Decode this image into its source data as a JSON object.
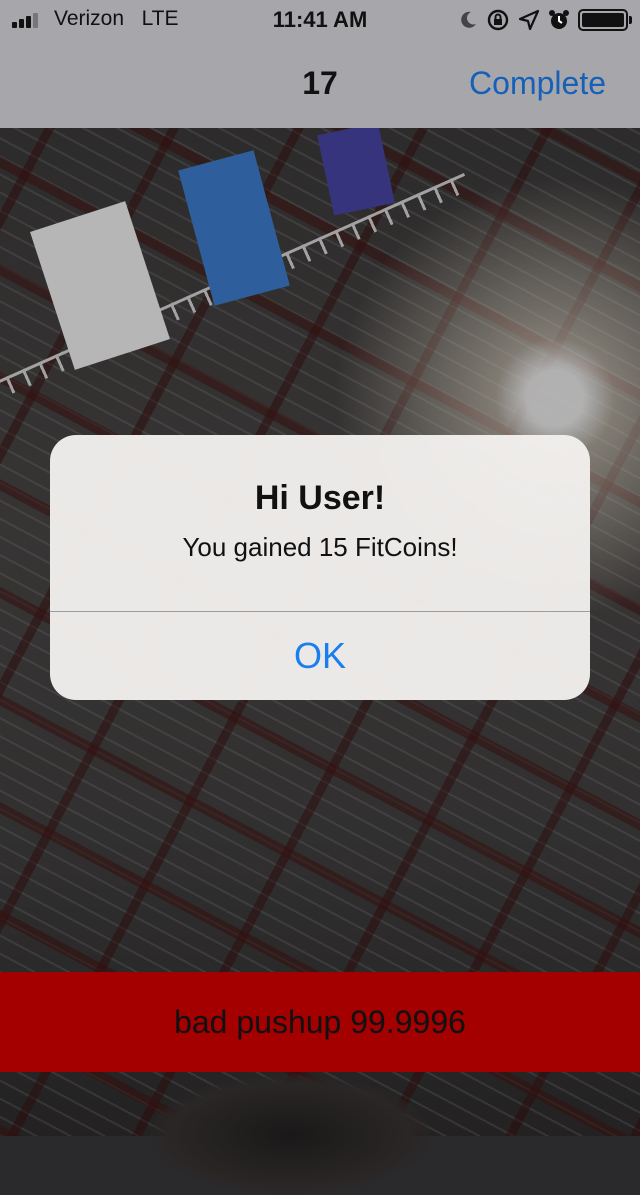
{
  "status_bar": {
    "carrier": "Verizon",
    "network": "LTE",
    "time": "11:41 AM",
    "icons": [
      "moon-icon",
      "rotation-lock-icon",
      "location-arrow-icon",
      "alarm-clock-icon",
      "battery-icon"
    ]
  },
  "nav": {
    "title": "17",
    "action_label": "Complete",
    "action_color": "#1560b8"
  },
  "alert": {
    "title": "Hi User!",
    "message": "You gained 15 FitCoins!",
    "button_label": "OK",
    "button_color": "#1a7ef0"
  },
  "banner": {
    "text": "bad pushup 99.9996",
    "color": "#a40000"
  }
}
